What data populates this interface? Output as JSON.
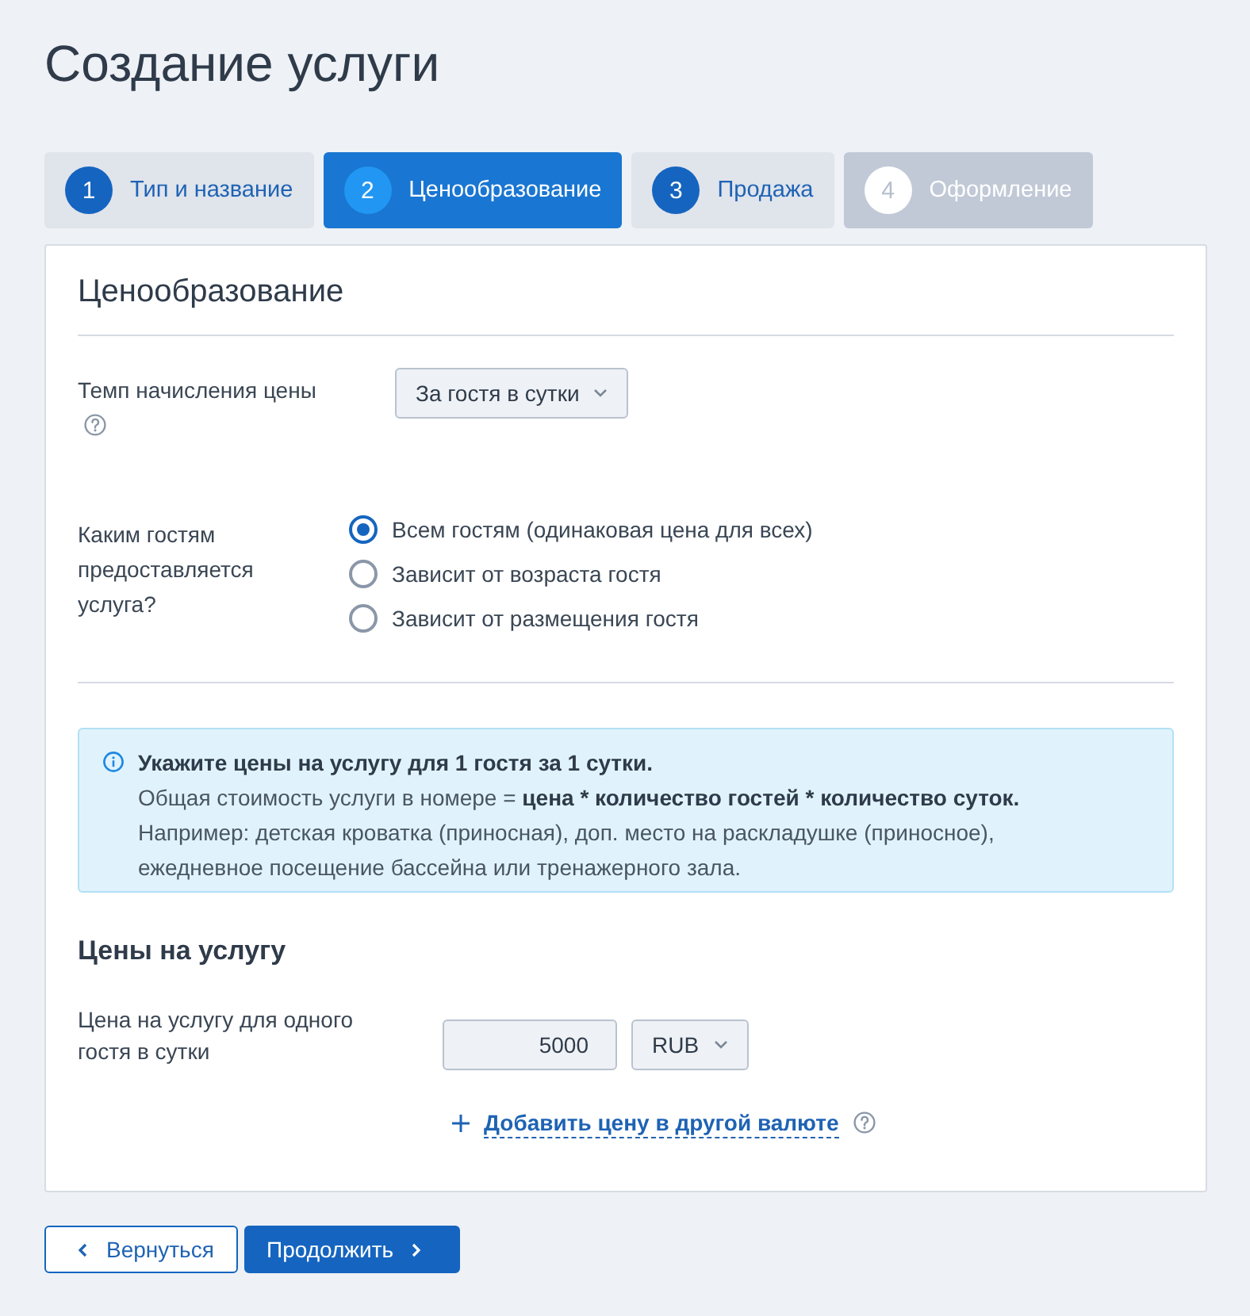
{
  "page": {
    "title": "Создание услуги"
  },
  "steps": [
    {
      "number": "1",
      "label": "Тип и название",
      "selected": false,
      "disabled": false
    },
    {
      "number": "2",
      "label": "Ценообразование",
      "selected": true,
      "disabled": false
    },
    {
      "number": "3",
      "label": "Продажа",
      "selected": false,
      "disabled": false
    },
    {
      "number": "4",
      "label": "Оформление",
      "selected": false,
      "disabled": true
    }
  ],
  "section": {
    "title": "Ценообразование",
    "rate": {
      "label": "Темп начисления цены",
      "value": "За гостя в сутки"
    },
    "guests": {
      "label": "Каким гостям предоставляется услуга?",
      "options": [
        {
          "label": "Всем гостям (одинаковая цена для всех)",
          "selected": true
        },
        {
          "label": "Зависит от возраста гостя",
          "selected": false
        },
        {
          "label": "Зависит от размещения гостя",
          "selected": false
        }
      ]
    },
    "info": {
      "title": "Укажите цены на услугу для 1 гостя за 1 сутки.",
      "formula": "Общая стоимость услуги в номере = **цена * количество гостей * количество суток.**",
      "example": "Например: детская кроватка (приносная), доп. место на раскладушке (приносное), ежедневное посещение бассейна или тренажерного зала."
    },
    "prices": {
      "title": "Цены на услугу",
      "label": "Цена на услугу для одного гостя в сутки",
      "value": "5000",
      "currency": "RUB",
      "add_link": "Добавить цену в другой валюте"
    }
  },
  "buttons": [
    {
      "kind": "back",
      "label": "Вернуться"
    },
    {
      "kind": "next",
      "label": "Продолжить"
    }
  ]
}
